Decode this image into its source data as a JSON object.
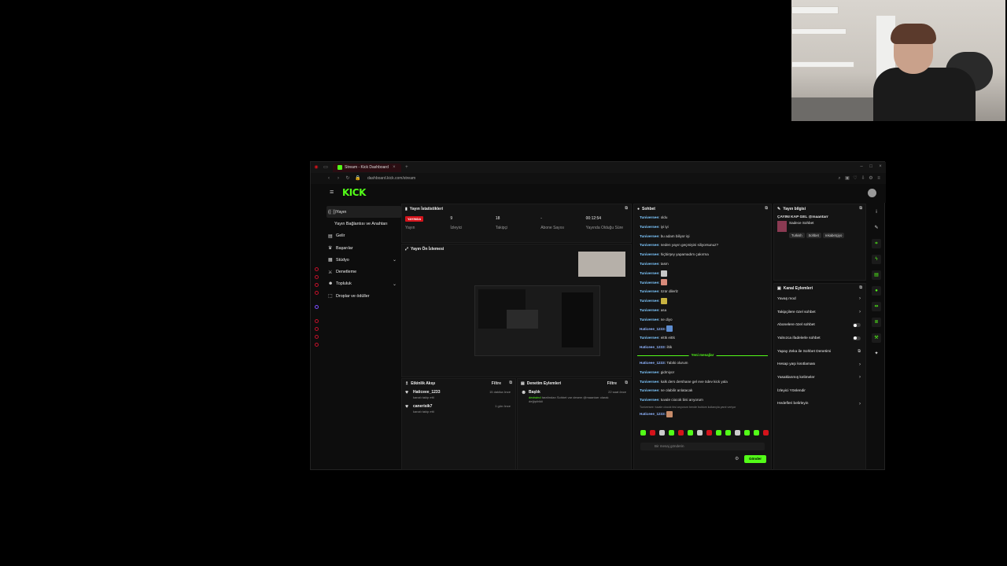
{
  "browser": {
    "tab_title": "Stream - Kick Dashboard",
    "new_tab": "+",
    "url": "dashboard.kick.com/stream"
  },
  "kick": {
    "logo": "KICK"
  },
  "sidebar": {
    "items": [
      {
        "label": "Yayın",
        "icon": "broadcast-icon"
      },
      {
        "label": "Yayın Bağlantısı ve Anahtarı"
      },
      {
        "label": "Gelir",
        "icon": "wallet-icon"
      },
      {
        "label": "Başarılar",
        "icon": "trophy-icon"
      },
      {
        "label": "Stüdyo",
        "icon": "studio-icon"
      },
      {
        "label": "Denetleme",
        "icon": "sword-icon"
      },
      {
        "label": "Topluluk",
        "icon": "people-icon"
      },
      {
        "label": "Droplar ve ödüller",
        "icon": "gift-icon"
      }
    ]
  },
  "stats": {
    "title": "Yayın İstatistikleri",
    "live_label": "YAYINDA",
    "items": [
      {
        "value": "9",
        "label": "İzleyici"
      },
      {
        "value": "18",
        "label": "Takipçi"
      },
      {
        "value": "-",
        "label": "Abone Sayısı"
      },
      {
        "value": "00:12:54",
        "label": "Yayında Olduğu Süre"
      }
    ],
    "first_label": "Yayın"
  },
  "preview": {
    "title": "Yayın Ön İzlemesi"
  },
  "activity": {
    "title": "Etkinlik Akışı",
    "filter": "Filtre",
    "items": [
      {
        "name": "Haticeee_1233",
        "sub": "kanalı takip etti",
        "time": "15 dakika önce"
      },
      {
        "name": "canerisik7",
        "sub": "kanalı takip etti",
        "time": "1 gün önce"
      }
    ]
  },
  "moderation": {
    "title": "Denetim Eylemleri",
    "filter": "Filtre",
    "item_title": "Başlık",
    "item_user": "deziwind",
    "item_text": "tarafından Sohbet var desem @maantarr olarak değiştirildi",
    "item_time": "22 saat önce"
  },
  "chat": {
    "title": "Sohbet",
    "messages": [
      {
        "user": "Tuniversee:",
        "text": "oldu"
      },
      {
        "user": "Tuniversee:",
        "text": "iyi iyi"
      },
      {
        "user": "Tuniversee:",
        "text": "bu adam biliyor işi"
      },
      {
        "user": "Tuniversee:",
        "text": "neden yayın geçmişini siliyorsunuz?"
      },
      {
        "user": "Tuniversee:",
        "text": "hiçbirşey yapamadım çakırma"
      },
      {
        "user": "Tuniversee:",
        "text": "tasm"
      },
      {
        "user": "Tuniversee:",
        "text": "",
        "emote": true
      },
      {
        "user": "Tuniversee:",
        "text": "",
        "emote": true
      },
      {
        "user": "Tuniversee:",
        "text": "özür dilerlz"
      },
      {
        "user": "Tuniversee:",
        "text": "",
        "emote": true
      },
      {
        "user": "Tuniversee:",
        "text": "asa"
      },
      {
        "user": "Tuniversee:",
        "text": "ne diyo"
      },
      {
        "user": "Haticeee_1233:",
        "text": "",
        "emote": true
      },
      {
        "user": "Tuniversee:",
        "text": "eittk eittk"
      },
      {
        "user": "Haticeee_1233:",
        "text": "iltik"
      }
    ],
    "divider": "Yeni mesajlar",
    "new_messages": [
      {
        "user": "Haticeee_1233:",
        "text": "Tabiki olurum"
      },
      {
        "user": "Tuniversee:",
        "text": "gidmiyor"
      },
      {
        "user": "Tuniversee:",
        "text": "kalk ders dershane gel eve ödev kick yala"
      },
      {
        "user": "Tuniversee:",
        "text": "ne olabilir anlatacak"
      },
      {
        "user": "Tuniversee:",
        "text": "tuvale ciocok bisi arıyorum"
      }
    ],
    "reply_hint": "Tuniversee: tuvale ciocok bisi arıyorum bende buldum kullanıyla yanıt veriyor",
    "last_user": "Haticeee_1233:",
    "placeholder": "Bir mesaj gönderin",
    "send": "Gönder"
  },
  "info": {
    "title": "Yayın bilgisi",
    "stream_title": "ÇAYINI KAP GEL @maantarr",
    "category": "Sadece Sohbet",
    "tags": [
      "Turkish",
      "Sohbet",
      "rekabetçiyo"
    ]
  },
  "channel": {
    "title": "Kanal Eylemleri",
    "items": [
      {
        "label": "Yavaş mod",
        "ctrl": "chevron"
      },
      {
        "label": "Takipçilere özel sohbet",
        "ctrl": "chevron"
      },
      {
        "label": "Abonelere özel sohbet",
        "ctrl": "toggle"
      },
      {
        "label": "Yalnızca ifadelerle sohbet",
        "ctrl": "toggle"
      },
      {
        "label": "Yapay Zeka ile Sohbet Denetimi",
        "ctrl": "ext"
      },
      {
        "label": "Hesap yaşı kısıtlaması",
        "ctrl": "chevron"
      },
      {
        "label": "Yasaklanmış kelimeler",
        "ctrl": "chevron"
      },
      {
        "label": "İzleyici Yönlendir",
        "ctrl": "none"
      },
      {
        "label": "Hedefleri belirleyin",
        "ctrl": "chevron"
      }
    ]
  },
  "colors": {
    "brand": "#53fc18",
    "live": "#d4131b"
  }
}
